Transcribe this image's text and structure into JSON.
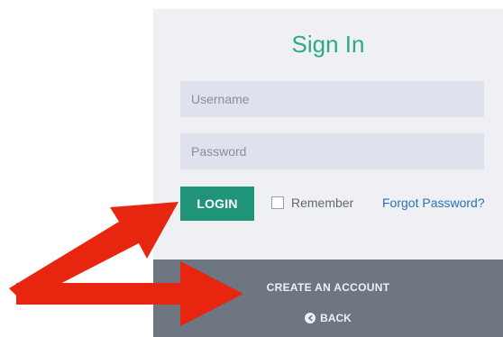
{
  "signin": {
    "title": "Sign In",
    "username_placeholder": "Username",
    "password_placeholder": "Password",
    "login_label": "LOGIN",
    "remember_label": "Remember",
    "forgot_label": "Forgot Password?"
  },
  "footer": {
    "create_account_label": "CREATE AN ACCOUNT",
    "back_label": "BACK",
    "back_icon": "back-circle-icon"
  },
  "annotation": {
    "arrow_color": "#e8260f",
    "arrow_count": 2
  },
  "colors": {
    "accent": "#2fa889",
    "button": "#1f9479",
    "link": "#2a73b8",
    "footer_bg": "#6d7681",
    "panel_bg": "#eef0f3",
    "field_bg": "#dfe2ec"
  }
}
